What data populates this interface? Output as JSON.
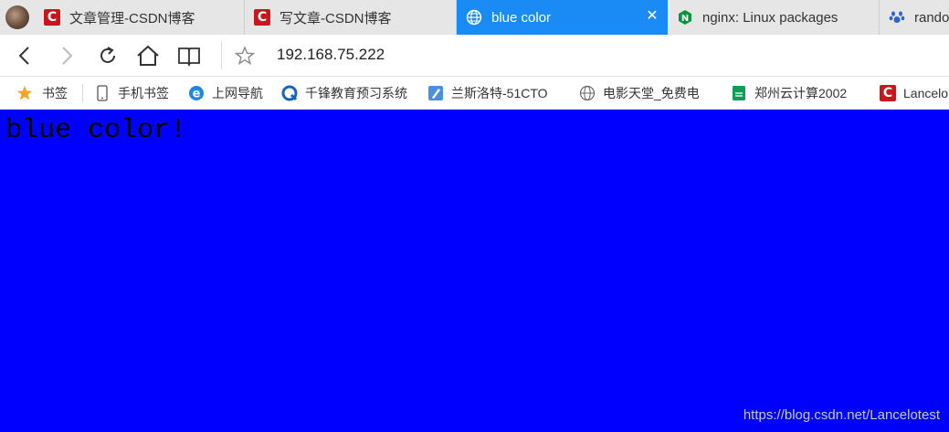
{
  "tabs": [
    {
      "title": "文章管理-CSDN博客",
      "icon": "csdn-icon",
      "active": false
    },
    {
      "title": "写文章-CSDN博客",
      "icon": "csdn-icon",
      "active": false
    },
    {
      "title": "blue color",
      "icon": "globe-icon",
      "active": true
    },
    {
      "title": "nginx: Linux packages",
      "icon": "nginx-icon",
      "active": false
    },
    {
      "title": "rando",
      "icon": "baidu-paw-icon",
      "active": false
    }
  ],
  "navbar": {
    "address": "192.168.75.222"
  },
  "bookmarks": [
    {
      "label": "书签",
      "icon": "star-icon"
    },
    {
      "label": "手机书签",
      "icon": "phone-icon"
    },
    {
      "label": "上网导航",
      "icon": "ie-icon"
    },
    {
      "label": "千锋教育预习系统",
      "icon": "qianfeng-icon"
    },
    {
      "label": "兰斯洛特-51CTO",
      "icon": "pen-icon"
    },
    {
      "label": "电影天堂_免费电",
      "icon": "globe-icon"
    },
    {
      "label": "郑州云计算2002",
      "icon": "sheet-icon"
    },
    {
      "label": "Lancelo",
      "icon": "csdn-icon"
    }
  ],
  "page": {
    "heading": "blue color!",
    "background": "#0000ff"
  },
  "watermark": "https://blog.csdn.net/Lancelotest",
  "colors": {
    "active_tab": "#1a8bf5",
    "csdn_red": "#c8161d",
    "nginx_green": "#009639"
  }
}
